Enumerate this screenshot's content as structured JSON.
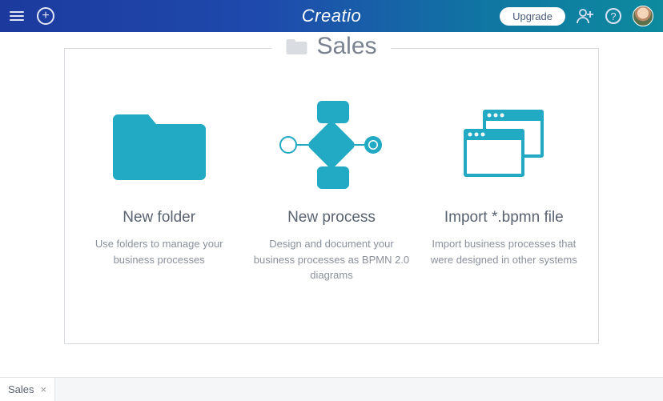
{
  "header": {
    "logo": "Creatio",
    "upgrade_label": "Upgrade"
  },
  "page": {
    "title": "Sales"
  },
  "cards": [
    {
      "title": "New folder",
      "description": "Use folders to manage your business processes"
    },
    {
      "title": "New process",
      "description": "Design and document your business processes as BPMN 2.0 diagrams"
    },
    {
      "title": "Import *.bpmn file",
      "description": "Import business processes that were designed in other systems"
    }
  ],
  "tabs": [
    {
      "label": "Sales"
    }
  ],
  "colors": {
    "accent": "#22a9c3"
  }
}
